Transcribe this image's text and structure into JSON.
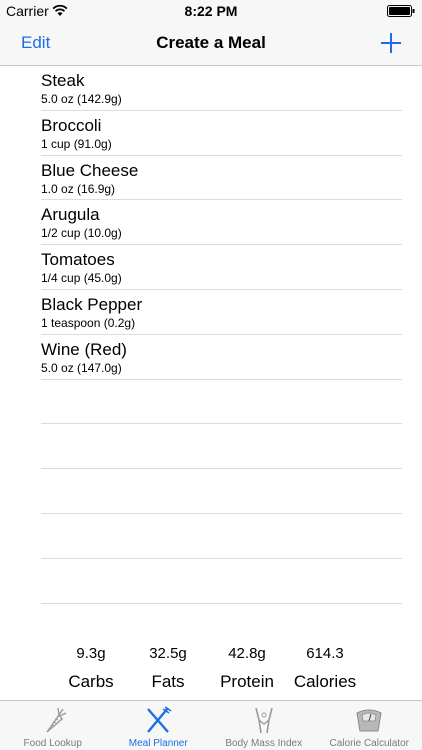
{
  "status": {
    "carrier": "Carrier",
    "time": "8:22 PM"
  },
  "nav": {
    "left": "Edit",
    "title": "Create a Meal"
  },
  "foods": [
    {
      "name": "Steak",
      "detail": "5.0 oz (142.9g)"
    },
    {
      "name": "Broccoli",
      "detail": "1 cup (91.0g)"
    },
    {
      "name": "Blue Cheese",
      "detail": "1.0 oz (16.9g)"
    },
    {
      "name": "Arugula",
      "detail": "1/2 cup (10.0g)"
    },
    {
      "name": "Tomatoes",
      "detail": "1/4 cup (45.0g)"
    },
    {
      "name": "Black Pepper",
      "detail": "1 teaspoon (0.2g)"
    },
    {
      "name": "Wine (Red)",
      "detail": "5.0 oz (147.0g)"
    }
  ],
  "totals": [
    {
      "value": "9.3g",
      "label": "Carbs"
    },
    {
      "value": "32.5g",
      "label": "Fats"
    },
    {
      "value": "42.8g",
      "label": "Protein"
    },
    {
      "value": "614.3",
      "label": "Calories"
    }
  ],
  "tabs": [
    {
      "label": "Food Lookup",
      "icon": "carrot-icon"
    },
    {
      "label": "Meal Planner",
      "icon": "fork-knife-icon"
    },
    {
      "label": "Body Mass Index",
      "icon": "body-icon"
    },
    {
      "label": "Calorie Calculator",
      "icon": "scale-icon"
    }
  ],
  "colors": {
    "accent": "#1b6ee6",
    "inactive": "#7a7a7a",
    "bar": "#f7f7f7"
  }
}
